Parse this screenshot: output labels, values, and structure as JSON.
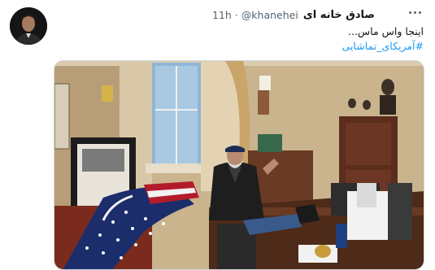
{
  "tweet": {
    "author_name": "صادق خانه ای",
    "handle": "@khanehei",
    "separator": "·",
    "time": "11h",
    "text_line": "اینجا واس ماس...",
    "hashtag": "#آمریکای_تماشایی",
    "more_icon": "more-horizontal-icon"
  },
  "media": {
    "description_icon": "photo"
  },
  "colors": {
    "accent": "#1d9bf0",
    "secondary_text": "#536471",
    "primary_text": "#0f1419"
  }
}
